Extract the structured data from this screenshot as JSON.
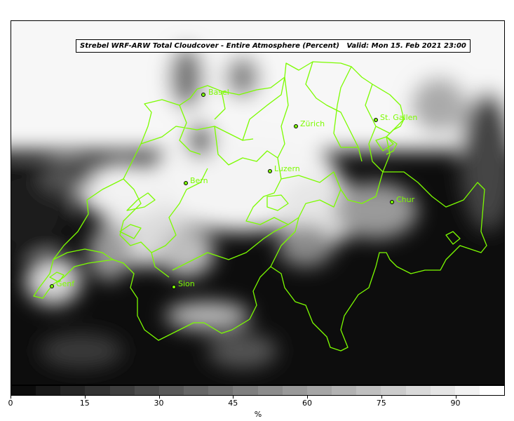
{
  "title": {
    "model": "Strebel WRF-ARW Total Cloudcover - Entire Atmosphere (Percent)",
    "valid": "Valid: Mon 15. Feb 2021 23:00"
  },
  "colors": {
    "border_line": "#7cfc00",
    "city_label": "#7cfc00"
  },
  "colorbar": {
    "unit": "%",
    "ticks": [
      {
        "value": 0,
        "label": "0"
      },
      {
        "value": 15,
        "label": "15"
      },
      {
        "value": 30,
        "label": "30"
      },
      {
        "value": 45,
        "label": "45"
      },
      {
        "value": 60,
        "label": "60"
      },
      {
        "value": 75,
        "label": "75"
      },
      {
        "value": 90,
        "label": "90"
      }
    ],
    "min": 0,
    "max": 100,
    "steps": 20
  },
  "cities": [
    {
      "name": "Basel",
      "label": "Basel"
    },
    {
      "name": "Zürich",
      "label": "Zürich"
    },
    {
      "name": "St. Gallen",
      "label": "St. Gallen"
    },
    {
      "name": "Luzern",
      "label": "Luzern"
    },
    {
      "name": "Bern",
      "label": "Bern"
    },
    {
      "name": "Chur",
      "label": "Chur"
    },
    {
      "name": "Genf",
      "label": "Genf"
    },
    {
      "name": "Sion",
      "label": "Sion"
    }
  ]
}
